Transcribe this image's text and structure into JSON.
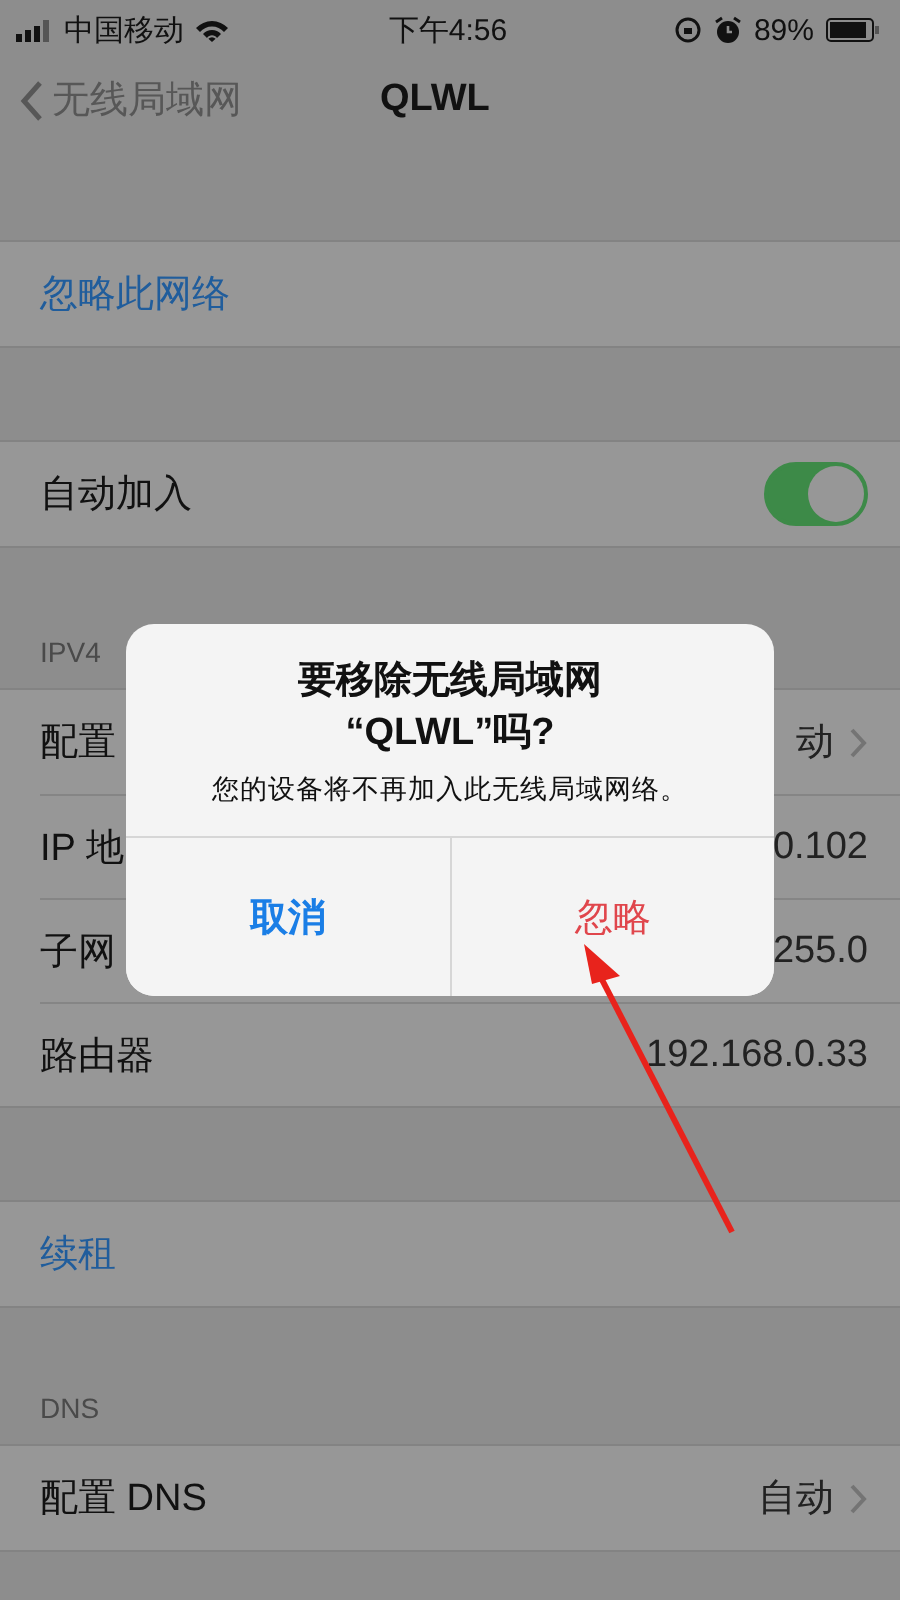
{
  "status_bar": {
    "carrier": "中国移动",
    "time": "下午4:56",
    "battery": "89%"
  },
  "nav": {
    "back": "无线局域网",
    "title": "QLWL"
  },
  "groups": [
    {
      "rows": [
        {
          "kind": "action",
          "label": "忽略此网络"
        }
      ]
    },
    {
      "rows": [
        {
          "kind": "toggle",
          "label": "自动加入",
          "on": true
        }
      ]
    },
    {
      "header": "IPV4",
      "rows": [
        {
          "kind": "value",
          "label": "配置",
          "value": "动",
          "chevron": true
        },
        {
          "kind": "value",
          "label": "IP 地",
          "value": "0.102",
          "chevron": false
        },
        {
          "kind": "value",
          "label": "子网",
          "value": "255.0",
          "chevron": false
        },
        {
          "kind": "value",
          "label": "路由器",
          "value": "192.168.0.33",
          "chevron": false
        }
      ]
    },
    {
      "rows": [
        {
          "kind": "action",
          "label": "续租"
        }
      ]
    },
    {
      "header": "DNS",
      "rows": [
        {
          "kind": "value",
          "label": "配置 DNS",
          "value": "自动",
          "chevron": true
        }
      ]
    }
  ],
  "alert": {
    "title": "要移除无线局域网\n“QLWL”吗?",
    "message": "您的设备将不再加入此无线局域网络。",
    "buttons": [
      {
        "label": "取消",
        "kind": "cancel"
      },
      {
        "label": "忽略",
        "kind": "destructive"
      }
    ]
  }
}
